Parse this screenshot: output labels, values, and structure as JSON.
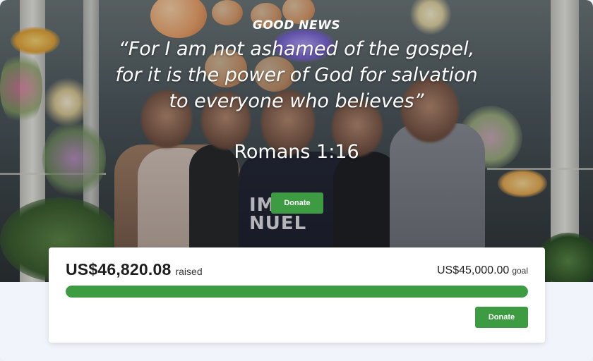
{
  "hero": {
    "eyebrow": "GOOD NEWS",
    "quote": "“For I am not ashamed of the gospel, for it is the power of God for salvation to everyone who believes”",
    "reference": "Romans 1:16",
    "shirt_text": "IMMA NUEL",
    "donate_label": "Donate"
  },
  "fundraiser": {
    "raised_amount": "US$46,820.08",
    "raised_label": "raised",
    "goal_amount": "US$45,000.00",
    "goal_label": "goal",
    "progress_fraction": 1.0,
    "donate_label": "Donate"
  },
  "colors": {
    "accent_green": "#3d9b41",
    "track": "#e6e6e6"
  }
}
